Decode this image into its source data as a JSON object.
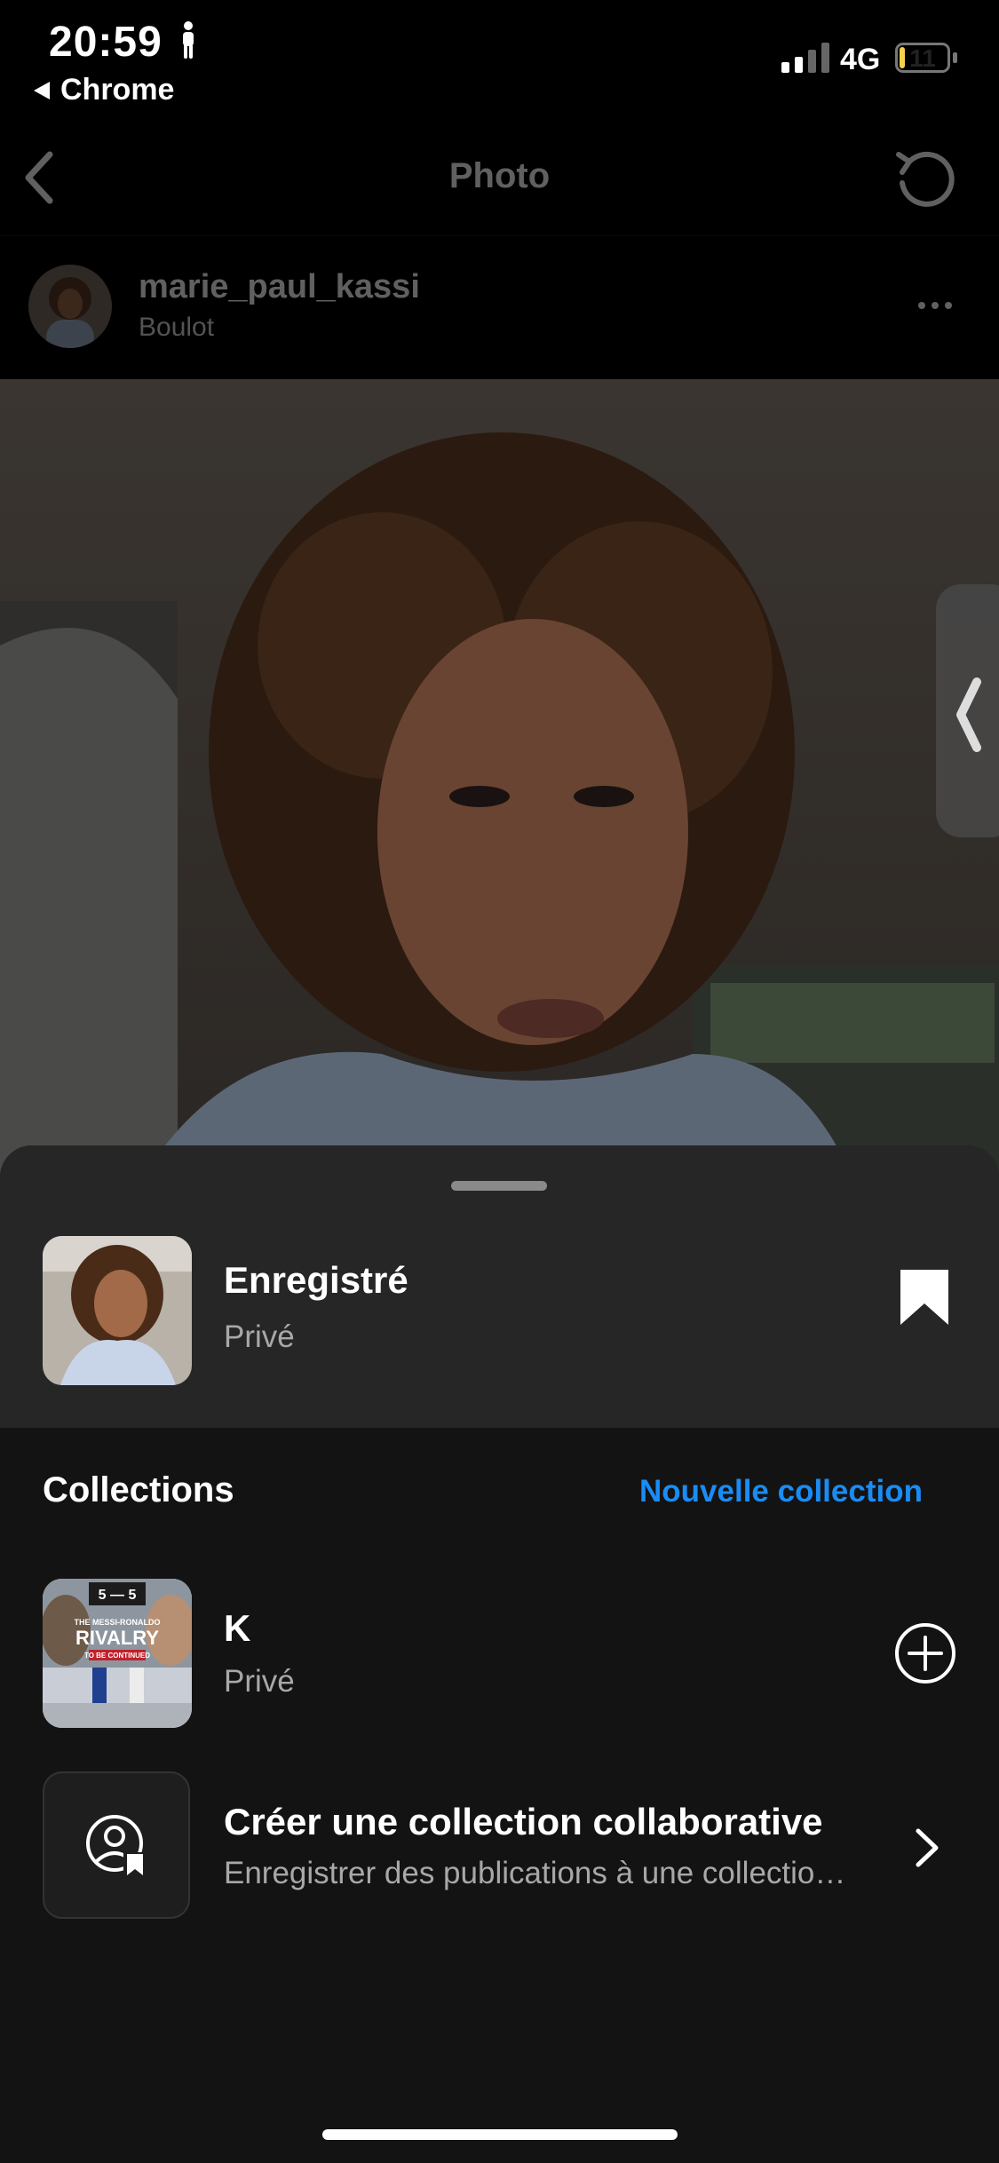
{
  "status_bar": {
    "time": "20:59",
    "back_app": "Chrome",
    "network": "4G",
    "battery": "11",
    "battery_level": 0.11
  },
  "nav": {
    "title": "Photo"
  },
  "post": {
    "username": "marie_paul_kassi",
    "location": "Boulot"
  },
  "sheet": {
    "saved": {
      "title": "Enregistré",
      "subtitle": "Privé"
    },
    "collections_label": "Collections",
    "new_collection": "Nouvelle collection",
    "collections": [
      {
        "title": "K",
        "subtitle": "Privé",
        "thumb_top": "5 — 5",
        "thumb_small": "THE MESSI-RONALDO",
        "thumb_big": "RIVALRY",
        "thumb_banner": "TO BE CONTINUED"
      }
    ],
    "collab": {
      "title": "Créer une collection collaborative",
      "subtitle": "Enregistrer des publications à une collection partagée"
    }
  },
  "colors": {
    "accent": "#1a8cf5",
    "sheet_top": "#262626",
    "sheet_bg": "#131313",
    "battery": "#f3d34a"
  },
  "icons": {
    "person": "standing-person-icon",
    "back": "chevron-left-icon",
    "refresh": "refresh-icon",
    "more": "more-dots-icon",
    "bookmark": "bookmark-filled-icon",
    "add": "plus-circle-icon",
    "collab": "collaborative-collection-icon",
    "chevron": "chevron-right-icon"
  }
}
